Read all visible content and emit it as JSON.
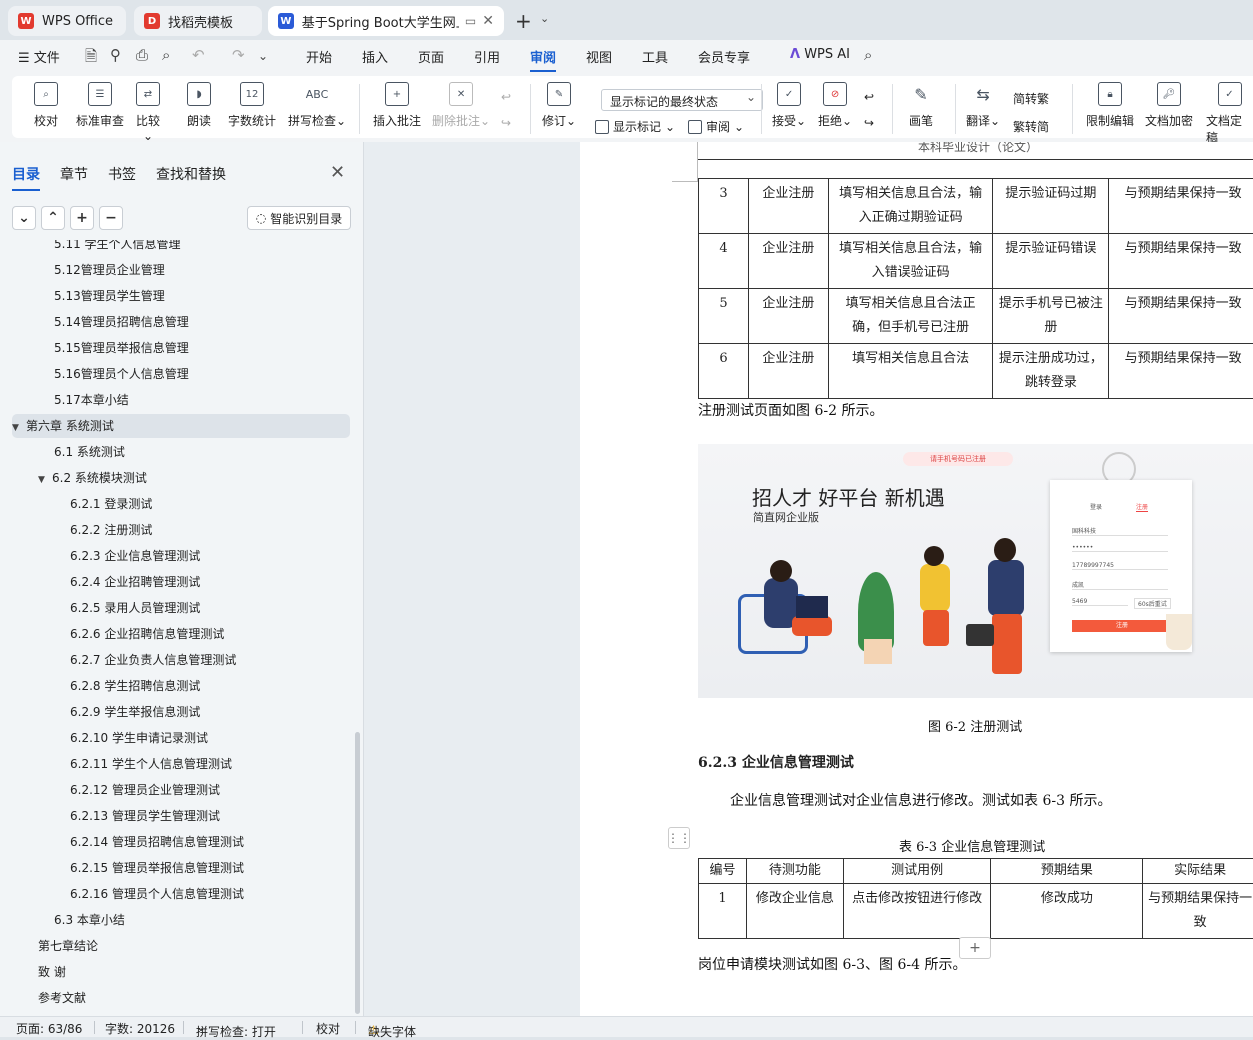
{
  "tabs": [
    {
      "label": "WPS Office",
      "logo": "W",
      "color": "#e23a2f"
    },
    {
      "label": "找稻壳模板",
      "logo": "D",
      "color": "#e23a2f"
    },
    {
      "label": "基于Spring Boot大学生网上",
      "logo": "W",
      "color": "#2b5bd7"
    }
  ],
  "menu": {
    "file": "文件",
    "items": [
      "开始",
      "插入",
      "页面",
      "引用",
      "审阅",
      "视图",
      "工具",
      "会员专享"
    ],
    "active": "审阅",
    "ai": "WPS AI"
  },
  "ribbon": {
    "proofread": "校对",
    "std_review": "标准审查",
    "compare": "比较",
    "read_aloud": "朗读",
    "word_count": "字数统计",
    "spell_check": "拼写检查",
    "insert_comment": "插入批注",
    "delete_comment": "删除批注",
    "track": "修订",
    "show_state": "显示标记的最终状态",
    "show_marks": "显示标记",
    "review": "审阅",
    "accept": "接受",
    "reject": "拒绝",
    "pen": "画笔",
    "translate": "翻译",
    "to_traditional": "简转繁",
    "to_simplified": "繁转简",
    "restrict_edit": "限制编辑",
    "doc_encrypt": "文档加密",
    "doc_finalize": "文档定稿",
    "abc": "ABC",
    "num12": "12"
  },
  "sidebar": {
    "tabs": [
      "目录",
      "章节",
      "书签",
      "查找和替换"
    ],
    "smart_toc": "智能识别目录",
    "toc": [
      {
        "text": "5.11 学生个人信息管理",
        "level": 2
      },
      {
        "text": "5.12管理员企业管理",
        "level": 2
      },
      {
        "text": "5.13管理员学生管理",
        "level": 2
      },
      {
        "text": "5.14管理员招聘信息管理",
        "level": 2
      },
      {
        "text": "5.15管理员举报信息管理",
        "level": 2
      },
      {
        "text": "5.16管理员个人信息管理",
        "level": 2
      },
      {
        "text": "5.17本章小结",
        "level": 2
      },
      {
        "text": "第六章  系统测试",
        "level": 1
      },
      {
        "text": "6.1 系统测试",
        "level": 2
      },
      {
        "text": "6.2 系统模块测试",
        "level": 2
      },
      {
        "text": "6.2.1 登录测试",
        "level": 3
      },
      {
        "text": "6.2.2 注册测试",
        "level": 3
      },
      {
        "text": "6.2.3 企业信息管理测试",
        "level": 3
      },
      {
        "text": "6.2.4 企业招聘管理测试",
        "level": 3
      },
      {
        "text": "6.2.5 录用人员管理测试",
        "level": 3
      },
      {
        "text": "6.2.6 企业招聘信息管理测试",
        "level": 3
      },
      {
        "text": "6.2.7 企业负责人信息管理测试",
        "level": 3
      },
      {
        "text": "6.2.8 学生招聘信息测试",
        "level": 3
      },
      {
        "text": "6.2.9 学生举报信息测试",
        "level": 3
      },
      {
        "text": "6.2.10 学生申请记录测试",
        "level": 3
      },
      {
        "text": "6.2.11 学生个人信息管理测试",
        "level": 3
      },
      {
        "text": "6.2.12 管理员企业管理测试",
        "level": 3
      },
      {
        "text": "6.2.13 管理员学生管理测试",
        "level": 3
      },
      {
        "text": "6.2.14 管理员招聘信息管理测试",
        "level": 3
      },
      {
        "text": "6.2.15 管理员举报信息管理测试",
        "level": 3
      },
      {
        "text": "6.2.16 管理员个人信息管理测试",
        "level": 3
      },
      {
        "text": "6.3 本章小结",
        "level": 2
      },
      {
        "text": "第七章结论",
        "level": 1
      },
      {
        "text": "致  谢",
        "level": 1
      },
      {
        "text": "参考文献",
        "level": 1
      }
    ]
  },
  "doc": {
    "header": "本科毕业设计（论文）",
    "table1": [
      [
        "3",
        "企业注册",
        "填写相关信息且合法，输入正确过期验证码",
        "提示验证码过期",
        "与预期结果保持一致"
      ],
      [
        "4",
        "企业注册",
        "填写相关信息且合法，输入错误验证码",
        "提示验证码错误",
        "与预期结果保持一致"
      ],
      [
        "5",
        "企业注册",
        "填写相关信息且合法正确，但手机号已注册",
        "提示手机号已被注册",
        "与预期结果保持一致"
      ],
      [
        "6",
        "企业注册",
        "填写相关信息且合法",
        "提示注册成功过，跳转登录",
        "与预期结果保持一致"
      ]
    ],
    "para1": "注册测试页面如图 6-2 所示。",
    "figure": {
      "slogan": "招人才 好平台 新机遇",
      "sub": "简直网企业版",
      "toast": "请手机号码已注册",
      "login_tab": "登录",
      "register_tab": "注册",
      "f1": "国科科技",
      "f2": "••••••",
      "f3": "17789997745",
      "f4": "成凯",
      "f5": "5469",
      "code": "60s后重试",
      "btn": "注册"
    },
    "fig_caption": "图 6-2 注册测试",
    "heading": "6.2.3 企业信息管理测试",
    "para2": "企业信息管理测试对企业信息进行修改。测试如表 6-3 所示。",
    "table2_caption": "表 6-3 企业信息管理测试",
    "table2_head": [
      "编号",
      "待测功能",
      "测试用例",
      "预期结果",
      "实际结果"
    ],
    "table2_rows": [
      [
        "1",
        "修改企业信息",
        "点击修改按钮进行修改",
        "修改成功",
        "与预期结果保持一致"
      ]
    ],
    "para3": "岗位申请模块测试如图 6-3、图 6-4 所示。"
  },
  "status": {
    "page": "页面: 63/86",
    "words": "字数: 20126",
    "spell": "拼写检查: 打开",
    "proof": "校对",
    "font_missing": "缺失字体"
  }
}
